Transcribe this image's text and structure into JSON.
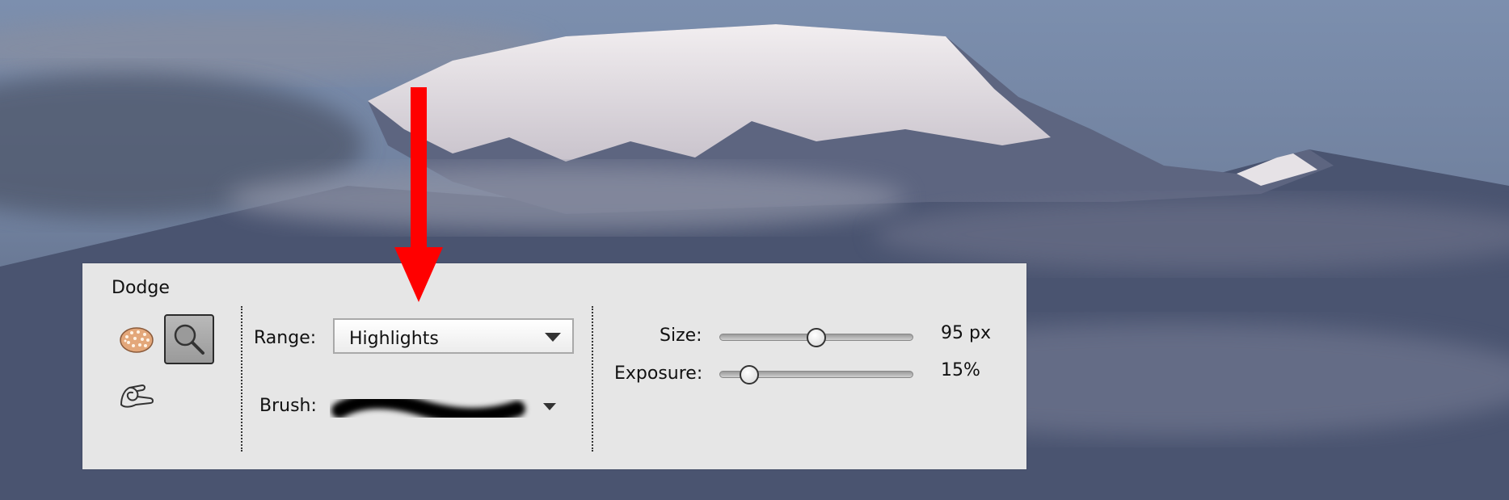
{
  "panel": {
    "tool_name": "Dodge",
    "tools": [
      {
        "icon": "sponge-icon"
      },
      {
        "icon": "dodge-icon",
        "selected": true
      },
      {
        "icon": "burn-icon"
      }
    ]
  },
  "range": {
    "label": "Range:",
    "value": "Highlights"
  },
  "brush": {
    "label": "Brush:"
  },
  "size": {
    "label": "Size:",
    "value": 95,
    "min": 0,
    "max": 190,
    "display": "95 px"
  },
  "exposure": {
    "label": "Exposure:",
    "value": 15,
    "min": 0,
    "max": 100,
    "display": "15%"
  },
  "colors": {
    "annotation_arrow": "#ff0000",
    "panel_bg": "#e6e6e6"
  }
}
